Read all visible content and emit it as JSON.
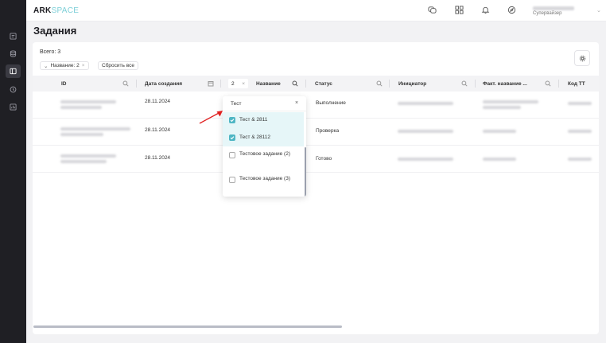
{
  "app": {
    "logo_main": "ARK",
    "logo_accent": "SPACE",
    "user_role": "Супервайзер"
  },
  "page": {
    "title": "Задания",
    "total": "Всего: 3",
    "filter_chip": "Название: 2",
    "reset_label": "Сбросить все"
  },
  "sidebar": {
    "items": [
      {
        "icon": "tasks-icon",
        "active": false
      },
      {
        "icon": "database-icon",
        "active": false
      },
      {
        "icon": "layout-icon",
        "active": true
      },
      {
        "icon": "clock-icon",
        "active": false
      },
      {
        "icon": "chart-icon",
        "active": false
      }
    ]
  },
  "table": {
    "columns": {
      "id": "ID",
      "created": "Дата создания",
      "name": "Название",
      "status": "Статус",
      "initiator": "Инициатор",
      "fact_name": "Факт. название ...",
      "code": "Код ТТ"
    },
    "name_filter_count": "2",
    "rows": [
      {
        "date": "28.11.2024",
        "status": "Выполнение"
      },
      {
        "date": "28.11.2024",
        "status": "Проверка"
      },
      {
        "date": "28.11.2024",
        "status": "Готово"
      }
    ]
  },
  "dropdown": {
    "search_value": "Тест",
    "clear": "×",
    "options": [
      {
        "label": "Тест & 2811",
        "checked": true
      },
      {
        "label": "Тест & 28112",
        "checked": true
      },
      {
        "label": "Тестовое задание (2)",
        "checked": false
      },
      {
        "label": "Тестовое задание (3)",
        "checked": false
      }
    ]
  },
  "colors": {
    "accent": "#4fb6c4",
    "sidebar": "#1f1f24",
    "arrow": "#e02020"
  }
}
